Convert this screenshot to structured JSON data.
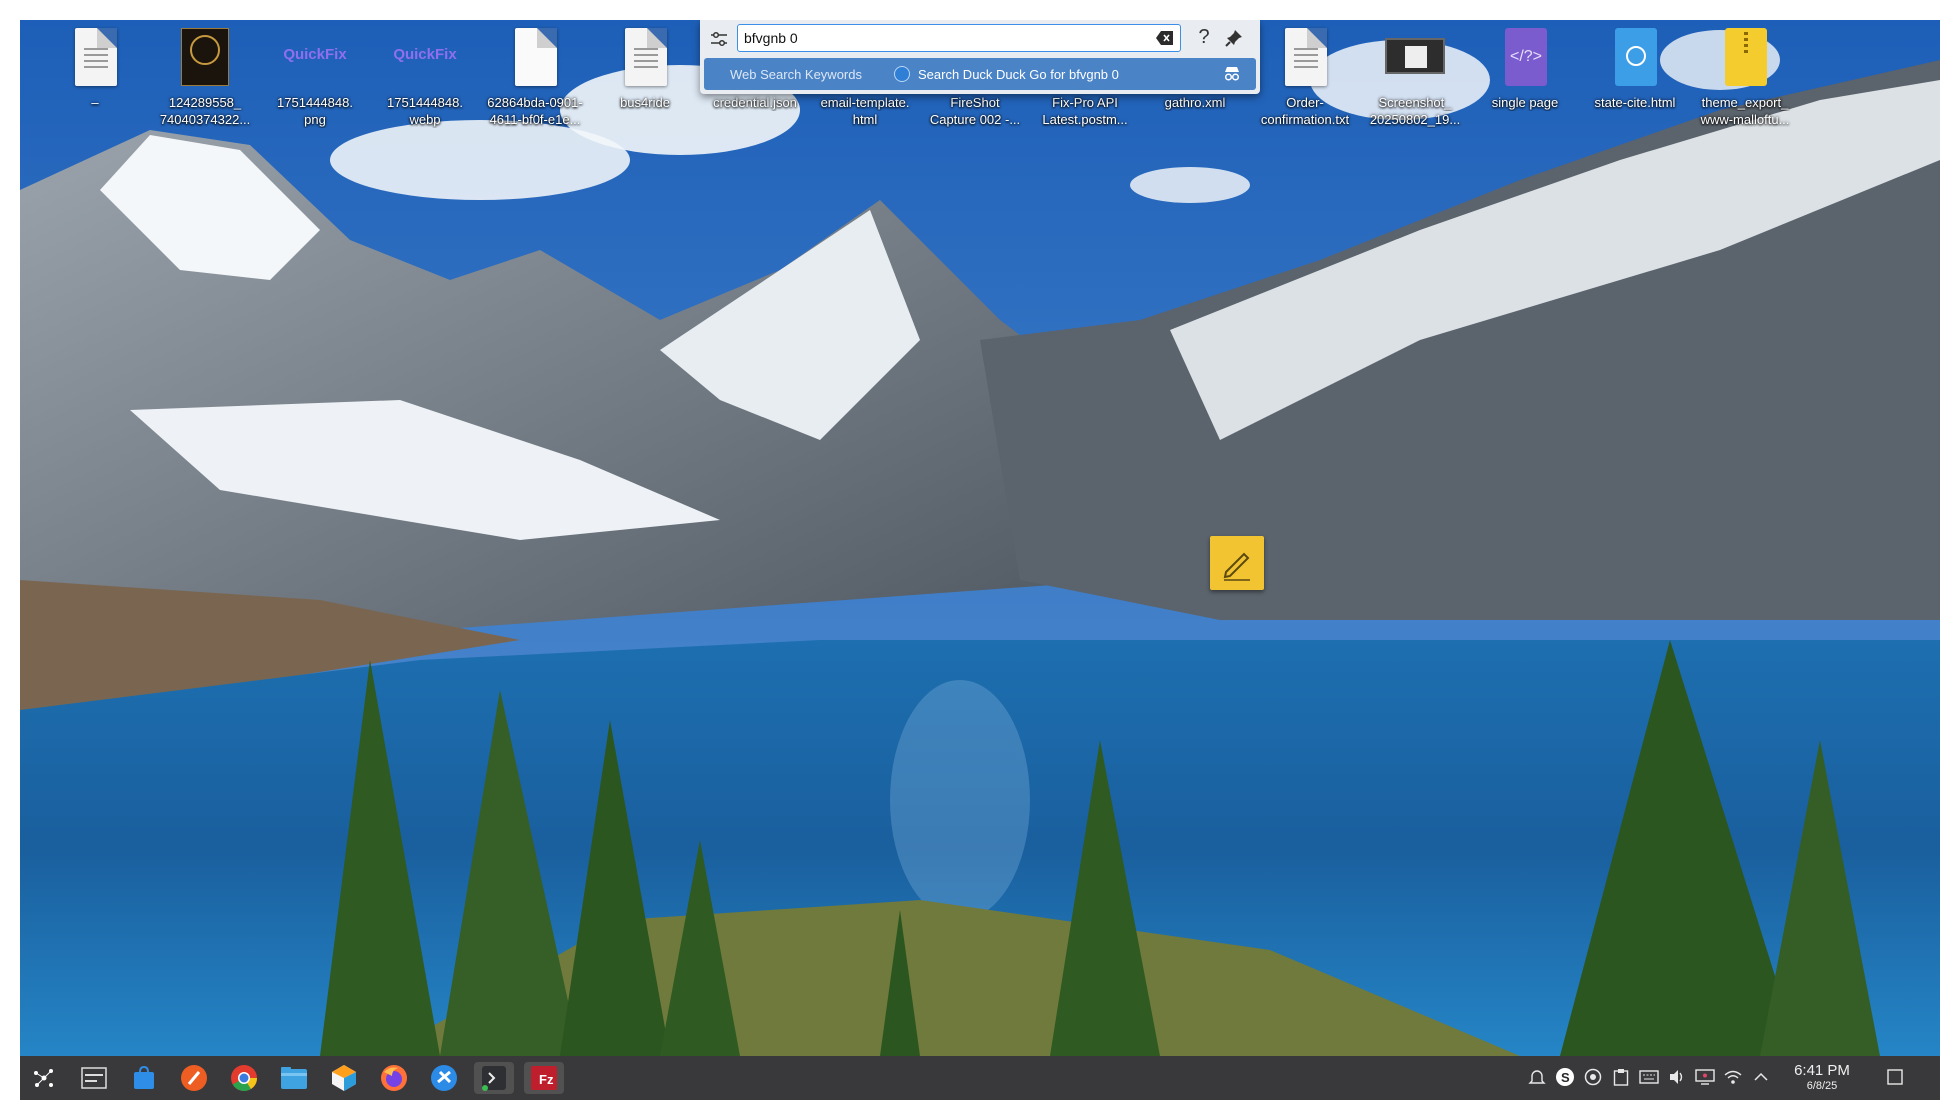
{
  "desktop": {
    "icons": [
      {
        "label1": "–",
        "label2": "",
        "icon": "text-file-icon"
      },
      {
        "label1": "124289558_",
        "label2": "74040374322...",
        "icon": "image-thumbnail-icon"
      },
      {
        "label1": "1751444848.",
        "label2": "png",
        "icon": "quickfix-logo-icon",
        "logo_text": "QuickFix"
      },
      {
        "label1": "1751444848.",
        "label2": "webp",
        "icon": "quickfix-logo-icon",
        "logo_text": "QuickFix"
      },
      {
        "label1": "62864bda-0901-",
        "label2": "4611-bf0f-e1e...",
        "icon": "blank-file-icon"
      },
      {
        "label1": "bus4ride",
        "label2": "",
        "icon": "text-file-icon"
      },
      {
        "label1": "credential.json",
        "label2": "",
        "icon": "json-file-icon"
      },
      {
        "label1": "email-template.",
        "label2": "html",
        "icon": "html-file-icon"
      },
      {
        "label1": "FireShot",
        "label2": "Capture 002 -...",
        "icon": "image-file-icon"
      },
      {
        "label1": "Fix-Pro API",
        "label2": "Latest.postm...",
        "icon": "file-icon"
      },
      {
        "label1": "gathro.xml",
        "label2": "",
        "icon": "xml-file-icon"
      },
      {
        "label1": "Order-",
        "label2": "confirmation.txt",
        "icon": "text-file-icon"
      },
      {
        "label1": "Screenshot_",
        "label2": "20250802_19...",
        "icon": "screenshot-thumbnail-icon"
      },
      {
        "label1": "single page",
        "label2": "",
        "icon": "code-file-icon"
      },
      {
        "label1": "state-cite.html",
        "label2": "",
        "icon": "web-file-icon"
      },
      {
        "label1": "theme_export_",
        "label2": "www-malloftu...",
        "icon": "zip-archive-icon"
      }
    ],
    "sticky_note_icon": "sticky-note-pencil-icon"
  },
  "krunner": {
    "query": "bfvgnb 0",
    "settings_icon": "settings-sliders-icon",
    "clear_icon": "clear-text-icon",
    "help_icon": "help-icon",
    "pin_icon": "pin-icon",
    "result_category": "Web Search Keywords",
    "result_text": "Search Duck Duck Go for bfvgnb 0",
    "result_icon": "globe-icon",
    "result_action_icon": "incognito-icon"
  },
  "taskbar": {
    "launchers": [
      "application-launcher-icon",
      "pager-icon",
      "discover-store-icon",
      "editor-icon",
      "chrome-icon",
      "file-manager-icon",
      "app-hexagon-icon",
      "firefox-icon",
      "network-app-icon",
      "terminal-icon",
      "filezilla-icon"
    ],
    "tray": [
      "notifications-icon",
      "skype-icon",
      "vpn-icon",
      "clipboard-icon",
      "keyboard-icon",
      "volume-icon",
      "display-icon",
      "wifi-icon",
      "expand-tray-icon"
    ],
    "clock_time": "6:41 PM",
    "clock_date": "6/8/25",
    "show_desktop_icon": "show-desktop-icon"
  },
  "colors": {
    "taskbar_bg": "#28282a",
    "highlight": "#4a83c6",
    "accent": "#3d8ee6"
  }
}
